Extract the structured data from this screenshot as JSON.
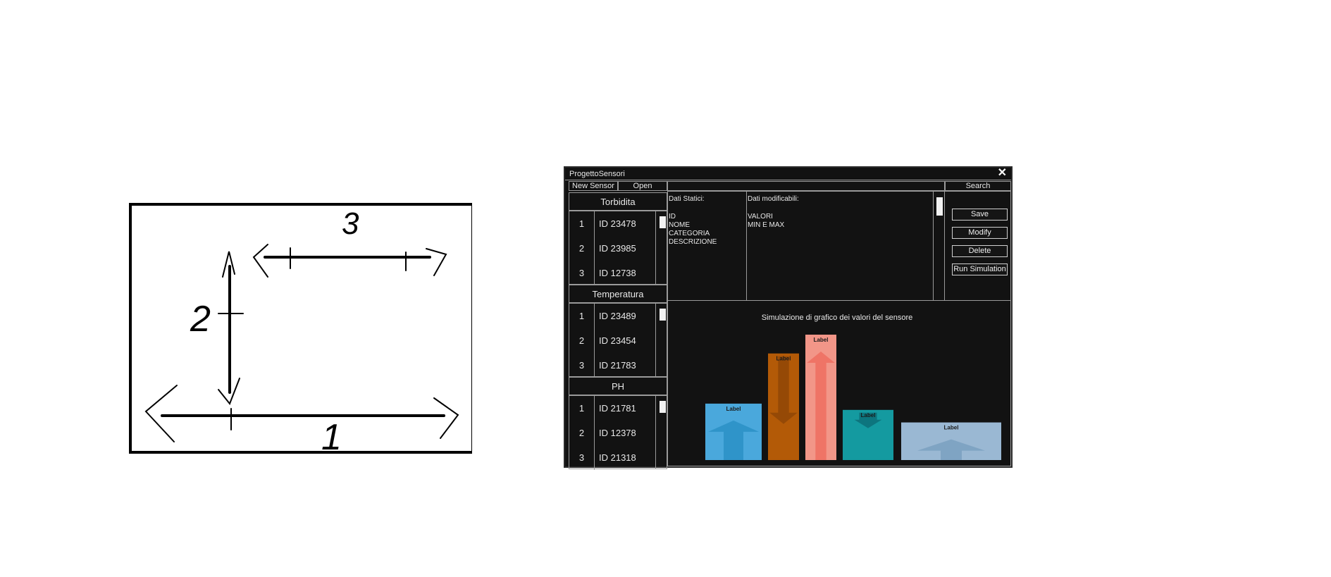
{
  "sketch": {
    "labels": [
      "3",
      "2",
      "1"
    ]
  },
  "app": {
    "title": "ProgettoSensori",
    "menu": {
      "new_sensor": "New Sensor",
      "open": "Open",
      "search": "Search"
    },
    "categories": [
      {
        "name": "Torbidita",
        "rows": [
          {
            "num": "1",
            "id": "ID 23478"
          },
          {
            "num": "2",
            "id": "ID 23985"
          },
          {
            "num": "3",
            "id": "ID 12738"
          }
        ]
      },
      {
        "name": "Temperatura",
        "rows": [
          {
            "num": "1",
            "id": "ID 23489"
          },
          {
            "num": "2",
            "id": "ID 23454"
          },
          {
            "num": "3",
            "id": "ID 21783"
          }
        ]
      },
      {
        "name": "PH",
        "rows": [
          {
            "num": "1",
            "id": "ID 21781"
          },
          {
            "num": "2",
            "id": "ID 12378"
          },
          {
            "num": "3",
            "id": "ID 21318"
          }
        ]
      }
    ],
    "static_data": {
      "heading": "Dati Statici:",
      "lines": [
        "ID",
        "NOME",
        "CATEGORIA",
        "DESCRIZIONE"
      ]
    },
    "editable_data": {
      "heading": "Dati modificabili:",
      "lines": [
        "VALORI",
        "MIN E MAX"
      ]
    },
    "actions": {
      "save": "Save",
      "modify": "Modify",
      "delete": "Delete",
      "run_simulation": "Run Simulation"
    },
    "chart_data": {
      "type": "bar",
      "title": "Simulazione di grafico dei valori del sensore",
      "categories": [
        "Label",
        "Label",
        "Label",
        "Label",
        "Label"
      ],
      "values": [
        45,
        85,
        100,
        40,
        30
      ],
      "colors": [
        "#4aa8dc",
        "#b35a07",
        "#f29688",
        "#149aa0",
        "#9ab8d3"
      ],
      "arrows": [
        "up",
        "down",
        "up",
        "down",
        "up"
      ]
    }
  }
}
